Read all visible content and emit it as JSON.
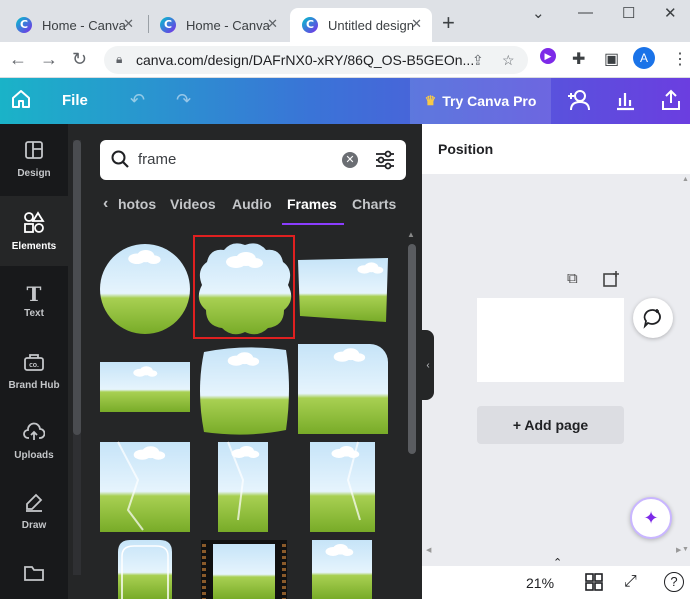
{
  "browser": {
    "tabs": [
      {
        "title": "Home - Canva",
        "active": false
      },
      {
        "title": "Home - Canva",
        "active": false
      },
      {
        "title": "Untitled design",
        "active": true
      }
    ],
    "new_tab": "+",
    "url": "canva.com/design/DAFrNX0-xRY/86Q_OS-B5GEOn...",
    "profile_initial": "A"
  },
  "topbar": {
    "file_label": "File",
    "try_pro_label": "Try Canva Pro"
  },
  "rail": {
    "items": [
      {
        "label": "Design",
        "icon": "design-icon"
      },
      {
        "label": "Elements",
        "icon": "elements-icon",
        "active": true
      },
      {
        "label": "Text",
        "icon": "text-icon"
      },
      {
        "label": "Brand Hub",
        "icon": "brand-hub-icon"
      },
      {
        "label": "Uploads",
        "icon": "uploads-icon"
      },
      {
        "label": "Draw",
        "icon": "draw-icon"
      },
      {
        "label": "",
        "icon": "projects-icon"
      }
    ]
  },
  "panel": {
    "search_value": "frame",
    "categories": [
      "hotos",
      "Videos",
      "Audio",
      "Frames",
      "Charts"
    ],
    "active_category": "Frames"
  },
  "canvas": {
    "panel_title": "Position",
    "add_page_label": "+ Add page",
    "zoom": "21%"
  },
  "colors": {
    "accent": "#8b3dff",
    "selection": "#e02020",
    "topbar_start": "#1ab3c8",
    "topbar_end": "#6b3ee0"
  }
}
